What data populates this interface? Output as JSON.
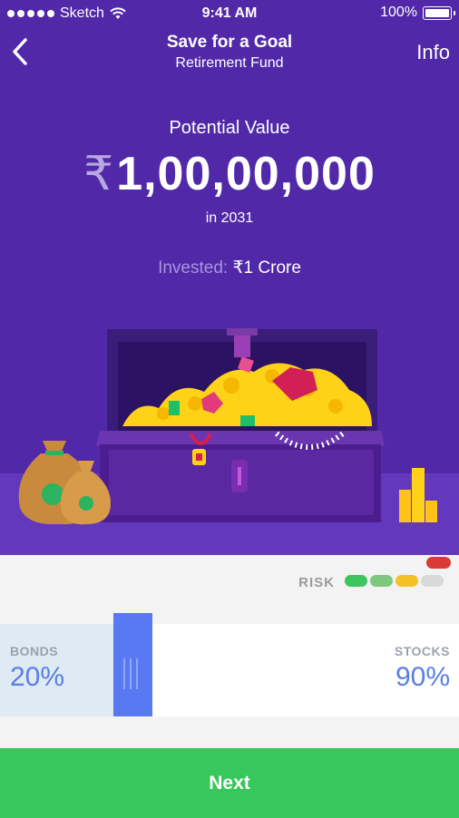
{
  "status_bar": {
    "carrier": "Sketch",
    "time": "9:41 AM",
    "battery": "100%"
  },
  "nav": {
    "title": "Save for a Goal",
    "subtitle": "Retirement Fund",
    "info": "Info"
  },
  "summary": {
    "label": "Potential Value",
    "currency": "₹",
    "amount": "1,00,00,000",
    "year": "in 2031",
    "invested_label": "Invested:",
    "invested_value": "₹1 Crore"
  },
  "risk": {
    "label": "RISK",
    "levels": [
      "#3dc45e",
      "#7fc77e",
      "#f5c026",
      "#d9d9d9"
    ],
    "marker_color": "#d93a33"
  },
  "allocation": {
    "bonds_label": "BONDS",
    "bonds_value": "20%",
    "stocks_label": "STOCKS",
    "stocks_value": "90%"
  },
  "cta": {
    "next": "Next"
  },
  "colors": {
    "primary": "#5129a8",
    "accent": "#5879f2",
    "cta": "#37c75a"
  }
}
